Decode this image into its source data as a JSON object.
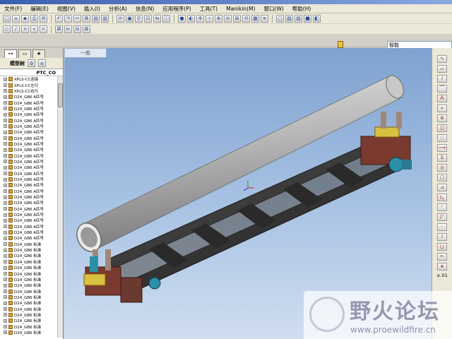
{
  "menu": [
    "文件(F)",
    "编辑(E)",
    "视图(V)",
    "插入(I)",
    "分析(A)",
    "信息(N)",
    "应用程序(P)",
    "工具(T)",
    "Manikin(M)",
    "窗口(W)",
    "帮助(H)"
  ],
  "toolbar": {
    "search_placeholder": "智能"
  },
  "left_panel": {
    "toolbar_label": "模型树",
    "header": "PTC_CO",
    "tree": [
      "XPLS-CC连接",
      "XPLS-CC左行",
      "XPLS-CC右行",
      "D24_GB6 A匹号",
      "D24_GB6 A匹号",
      "D24_GB6 A匹号",
      "D24_GB6 A匹号",
      "D24_GB6 A匹号",
      "D24_GB6 A匹号",
      "D24_GB6 A匹号",
      "D24_GB6 A匹号",
      "D24_GB6 A匹号",
      "D24_GB6 A匹号",
      "D24_GB6 A匹号",
      "D24_GB6 A匹号",
      "D24_GB6 A匹号",
      "D24_GB6 A匹号",
      "D24_GB6 A匹号",
      "D24_GB6 A匹号",
      "D24_GB6 A匹号",
      "D24_GB6 A匹号",
      "D24_GB6 A匹号",
      "D24_GB6 A匹号",
      "D24_GB6 A匹号",
      "D24_GB6 A匹号",
      "D24_GB6 A匹号",
      "D24_GB6 A匹号",
      "D24_GB6 A匹号",
      "D24_GB6 标准",
      "D24_GB6 标准",
      "D24_GB6 标准",
      "D24_GB6 标准",
      "D24_GB6 标准",
      "D24_GB6 标准",
      "D24_GB6 标准",
      "D24_GB6 标准",
      "D24_GB6 标准",
      "D24_GB6 标准",
      "D24_GB6 标准",
      "D24_GB6 标准",
      "D24_GB6 标准",
      "D24_GB6 标准",
      "D24_GB6 标准",
      "D24_GB6 标准"
    ]
  },
  "viewport": {
    "tab_label": "一般"
  },
  "rightbar": {
    "text_label": "±.01"
  },
  "watermark": {
    "title": "野火论坛",
    "url": "www.proewildfire.cn"
  },
  "colors": {
    "bg_top": "#7fa2d0",
    "bg_bottom": "#d0def0",
    "pipe": "#b8b8b8",
    "frame": "#3a3a3a",
    "accent": "#c87020"
  }
}
